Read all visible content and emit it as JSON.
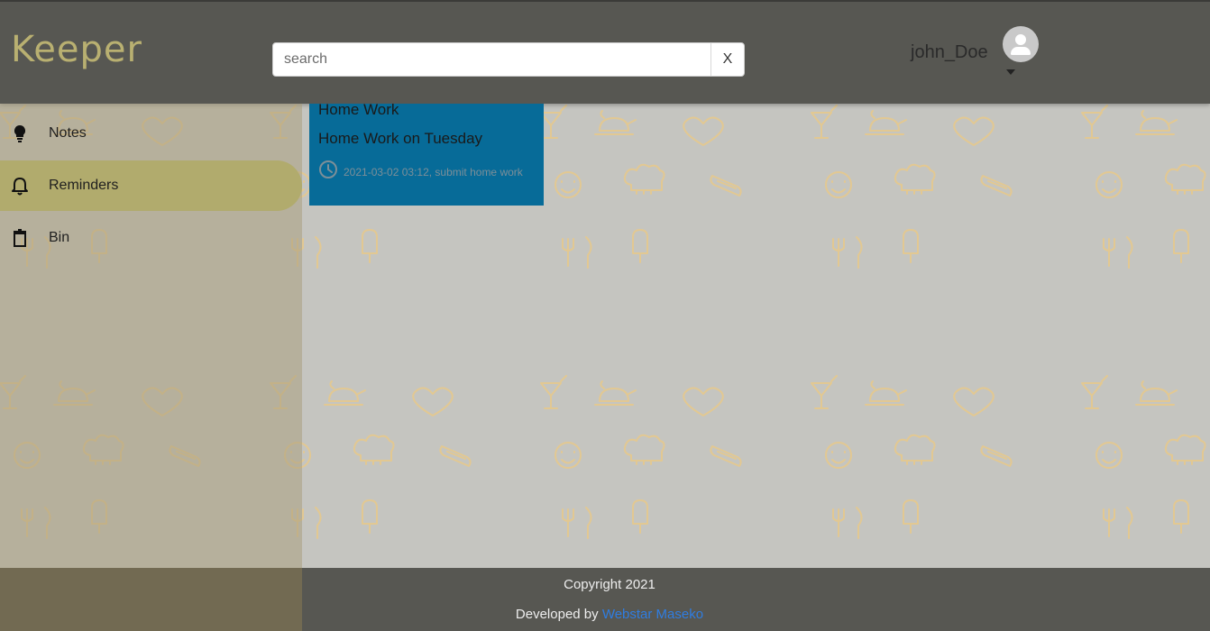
{
  "header": {
    "logo": "Keeper",
    "search": {
      "placeholder": "search",
      "value": "",
      "clear_label": "X"
    },
    "user": {
      "name": "john_Doe",
      "avatar_icon": "account-circle-icon",
      "menu_icon": "caret-down-icon"
    }
  },
  "sidebar": {
    "items": [
      {
        "label": "Notes",
        "icon": "lightbulb-icon",
        "active": false
      },
      {
        "label": "Reminders",
        "icon": "bell-icon",
        "active": true
      },
      {
        "label": "Bin",
        "icon": "trash-icon",
        "active": false
      }
    ]
  },
  "notes": [
    {
      "title": "Home Work",
      "body": "Home Work on Tuesday",
      "reminder": "2021-03-02 03:12, submit home work",
      "reminder_icon": "clock-icon",
      "color": "#076b98"
    }
  ],
  "footer": {
    "copyright": "Copyright 2021",
    "developed_prefix": "Developed by ",
    "developer": "Webstar Maseko"
  },
  "colors": {
    "header_bg": "#575752",
    "logo": "#b9b071",
    "active_nav": "#b1ab6d",
    "note_card": "#076b98",
    "pattern_icon": "#e8c98a",
    "link": "#2f7de1"
  }
}
